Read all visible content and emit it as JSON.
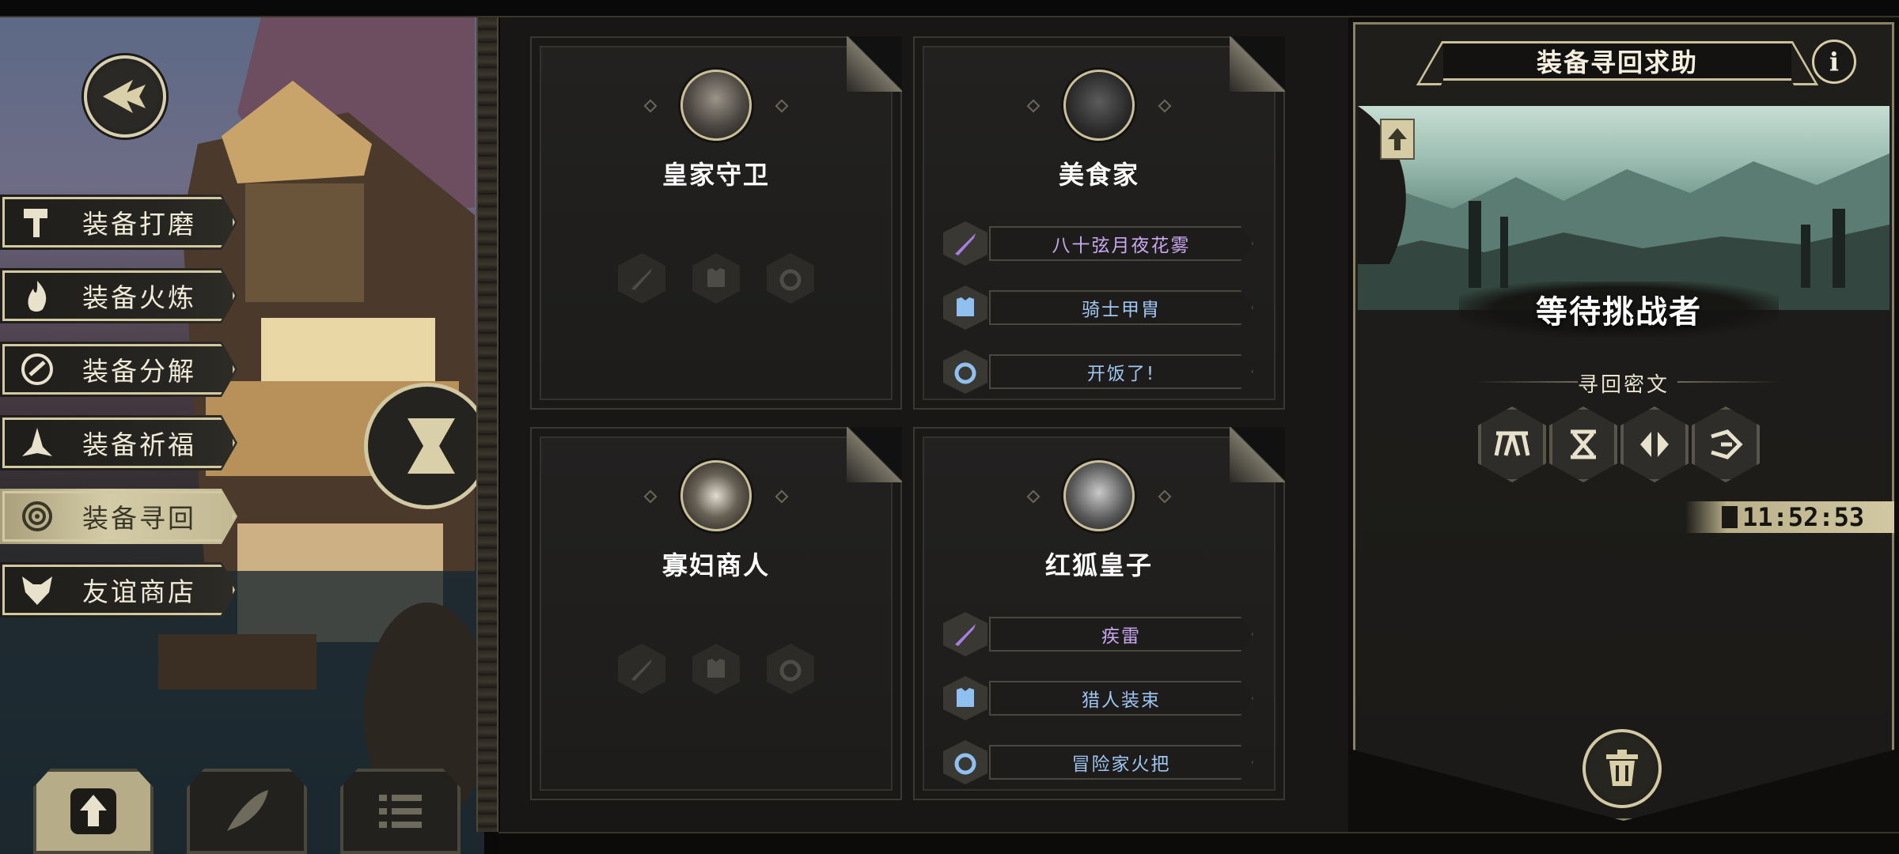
{
  "side_menu": {
    "items": [
      {
        "label": "装备打磨",
        "icon": "hammer-icon",
        "active": false
      },
      {
        "label": "装备火炼",
        "icon": "flame-icon",
        "active": false
      },
      {
        "label": "装备分解",
        "icon": "disassemble-icon",
        "active": false
      },
      {
        "label": "装备祈福",
        "icon": "praying-hands-icon",
        "active": false
      },
      {
        "label": "装备寻回",
        "icon": "spiral-icon",
        "active": true
      },
      {
        "label": "友谊商店",
        "icon": "fox-icon",
        "active": false
      }
    ]
  },
  "bottom_tabs": [
    {
      "icon": "upload-icon",
      "active": true
    },
    {
      "icon": "feather-icon",
      "active": false
    },
    {
      "icon": "list-icon",
      "active": false
    }
  ],
  "cards": [
    {
      "name": "皇家守卫",
      "equipment": []
    },
    {
      "name": "美食家",
      "equipment": [
        {
          "type": "weapon",
          "label": "八十弦月夜花雾",
          "rarity": "purple"
        },
        {
          "type": "armor",
          "label": "骑士甲胄",
          "rarity": "blue"
        },
        {
          "type": "ring",
          "label": "开饭了!",
          "rarity": "blue"
        }
      ]
    },
    {
      "name": "寡妇商人",
      "equipment": []
    },
    {
      "name": "红狐皇子",
      "equipment": [
        {
          "type": "weapon",
          "label": "疾雷",
          "rarity": "purple"
        },
        {
          "type": "armor",
          "label": "猎人装束",
          "rarity": "blue"
        },
        {
          "type": "ring",
          "label": "冒险家火把",
          "rarity": "blue"
        }
      ]
    }
  ],
  "right_panel": {
    "title": "装备寻回求助",
    "info_label": "i",
    "status": "等待挑战者",
    "cipher_label": "寻回密文",
    "runes": [
      "rune-1-icon",
      "rune-2-icon",
      "rune-3-icon",
      "rune-4-icon"
    ],
    "timer": "11:52:53"
  },
  "colors": {
    "gold_border": "#d2c8a2",
    "purple_text": "#c9a8f0",
    "blue_text": "#9fc6f2",
    "active_tab": "#d4cca7"
  }
}
